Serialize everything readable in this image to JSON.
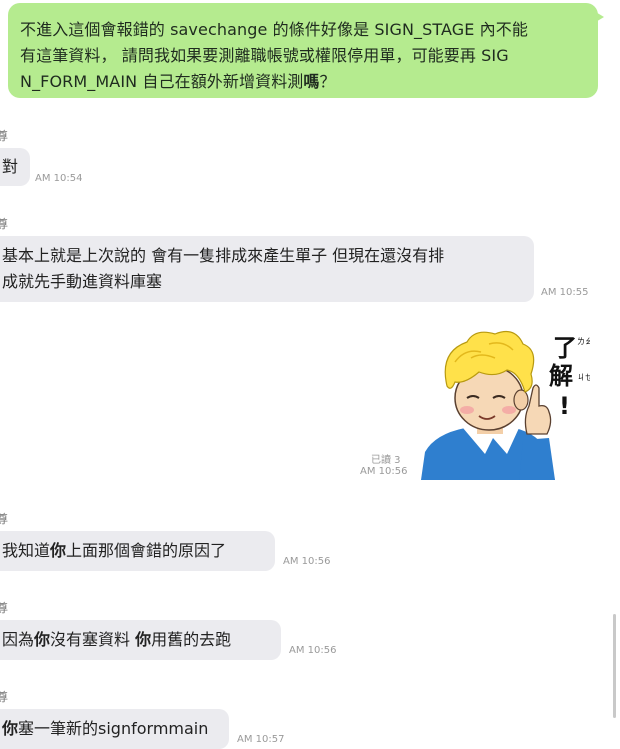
{
  "messages": {
    "m1": {
      "text_line1": "不進入這個會報錯的 savechange 的條件好像是 SIGN_STAGE 內不能",
      "text_line2": "有這筆資料， 請問我如果要測離職帳號或權限停用單，可能要再 SIG",
      "text_line3a": "N_FORM_MAIN 自己在額外新增資料測",
      "text_line3b": "嗎",
      "text_line3c": "？"
    },
    "m2": {
      "sender": "尊",
      "text": "對",
      "time": "AM 10:54"
    },
    "m3": {
      "sender": "尊",
      "text_line1": "基本上就是上次說的 會有一隻排成來產生單子 但現在還沒有排",
      "text_line2": "成就先手動進資料庫塞",
      "time": "AM 10:55"
    },
    "m4": {
      "sticker_text_main1": "了",
      "sticker_text_main2": "解",
      "sticker_text_excl": "!",
      "sticker_bopo1": "ㄌㄠ",
      "sticker_bopo2": "ㄐㄝ",
      "read": "已讀 3",
      "time": "AM 10:56"
    },
    "m5": {
      "sender": "尊",
      "text_a": "我知道",
      "text_b": "你",
      "text_c": "上面那個會錯的原因了",
      "time": "AM 10:56"
    },
    "m6": {
      "sender": "尊",
      "text_a": "因為",
      "text_b": "你",
      "text_c": "沒有塞資料 ",
      "text_d": "你",
      "text_e": "用舊的去跑",
      "time": "AM 10:56"
    },
    "m7": {
      "sender": "尊",
      "text_a": "你",
      "text_b": "塞一筆新的signformmain",
      "time": "AM 10:57"
    }
  },
  "colors": {
    "outgoing_bubble": "#b5eb8f",
    "incoming_bubble": "#ebebef",
    "timestamp": "#9a9a9a"
  }
}
